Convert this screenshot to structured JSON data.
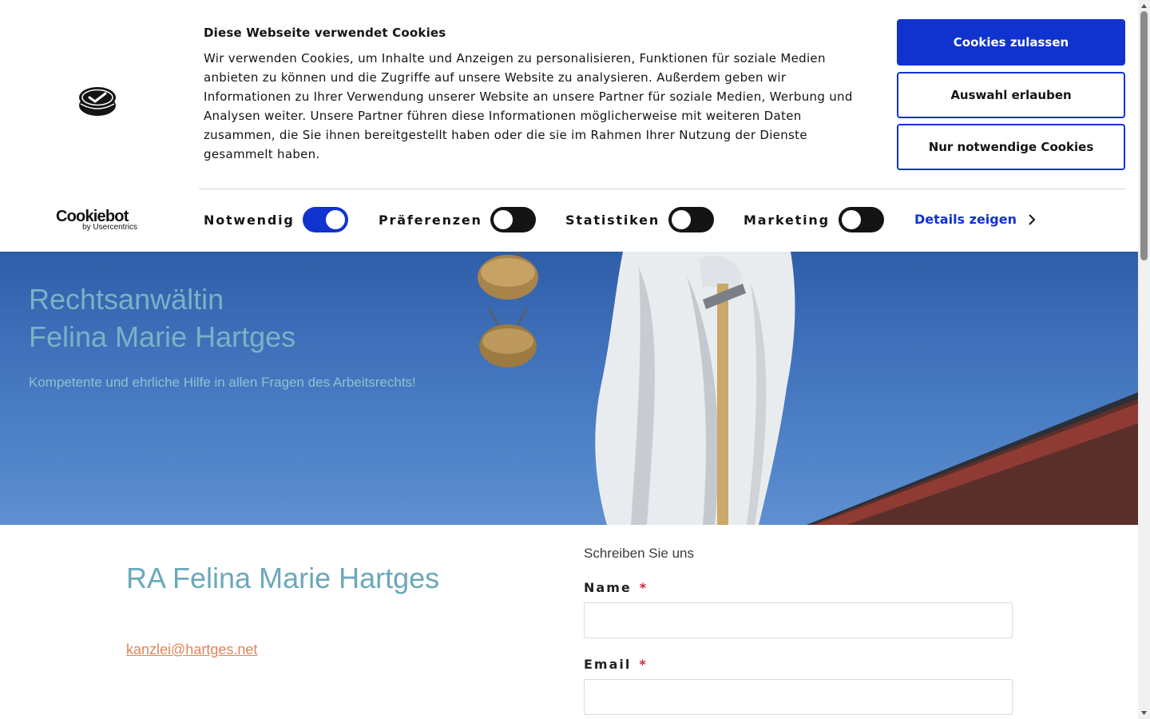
{
  "cookie_banner": {
    "title": "Diese Webseite verwendet Cookies",
    "text": "Wir verwenden Cookies, um Inhalte und Anzeigen zu personalisieren, Funktionen für soziale Medien anbieten zu können und die Zugriffe auf unsere Website zu analysieren. Außerdem geben wir Informationen zu Ihrer Verwendung unserer Website an unsere Partner für soziale Medien, Werbung und Analysen weiter. Unsere Partner führen diese Informationen möglicherweise mit weiteren Daten zusammen, die Sie ihnen bereitgestellt haben oder die sie im Rahmen Ihrer Nutzung der Dienste gesammelt haben.",
    "buttons": {
      "allow_all": "Cookies zulassen",
      "allow_selection": "Auswahl erlauben",
      "necessary_only": "Nur notwendige Cookies"
    },
    "logo": {
      "word": "Cookiebot",
      "sub": "by Usercentrics"
    },
    "toggles": [
      {
        "label": "Notwendig",
        "on": true
      },
      {
        "label": "Präferenzen",
        "on": false
      },
      {
        "label": "Statistiken",
        "on": false
      },
      {
        "label": "Marketing",
        "on": false
      }
    ],
    "details_link": "Details zeigen",
    "icons": {
      "brand": "cookiebot-brand-icon",
      "details": "chevron-right-icon"
    }
  },
  "hero": {
    "title_line1": "Rechtsanwältin",
    "title_line2": "Felina Marie Hartges",
    "subtitle": "Kompetente und ehrliche Hilfe in allen Fragen des Arbeitsrechts!"
  },
  "contact": {
    "name": "RA Felina Marie Hartges",
    "email": "kanzlei@hartges.net"
  },
  "form": {
    "heading": "Schreiben Sie uns",
    "name_label": "Name",
    "email_label": "Email",
    "required_mark": "*",
    "name_value": "",
    "email_value": ""
  },
  "colors": {
    "primary_blue": "#1032cf",
    "accent_teal": "#6aa8bb",
    "link_orange": "#e0855a",
    "required_red": "#d2243b"
  }
}
